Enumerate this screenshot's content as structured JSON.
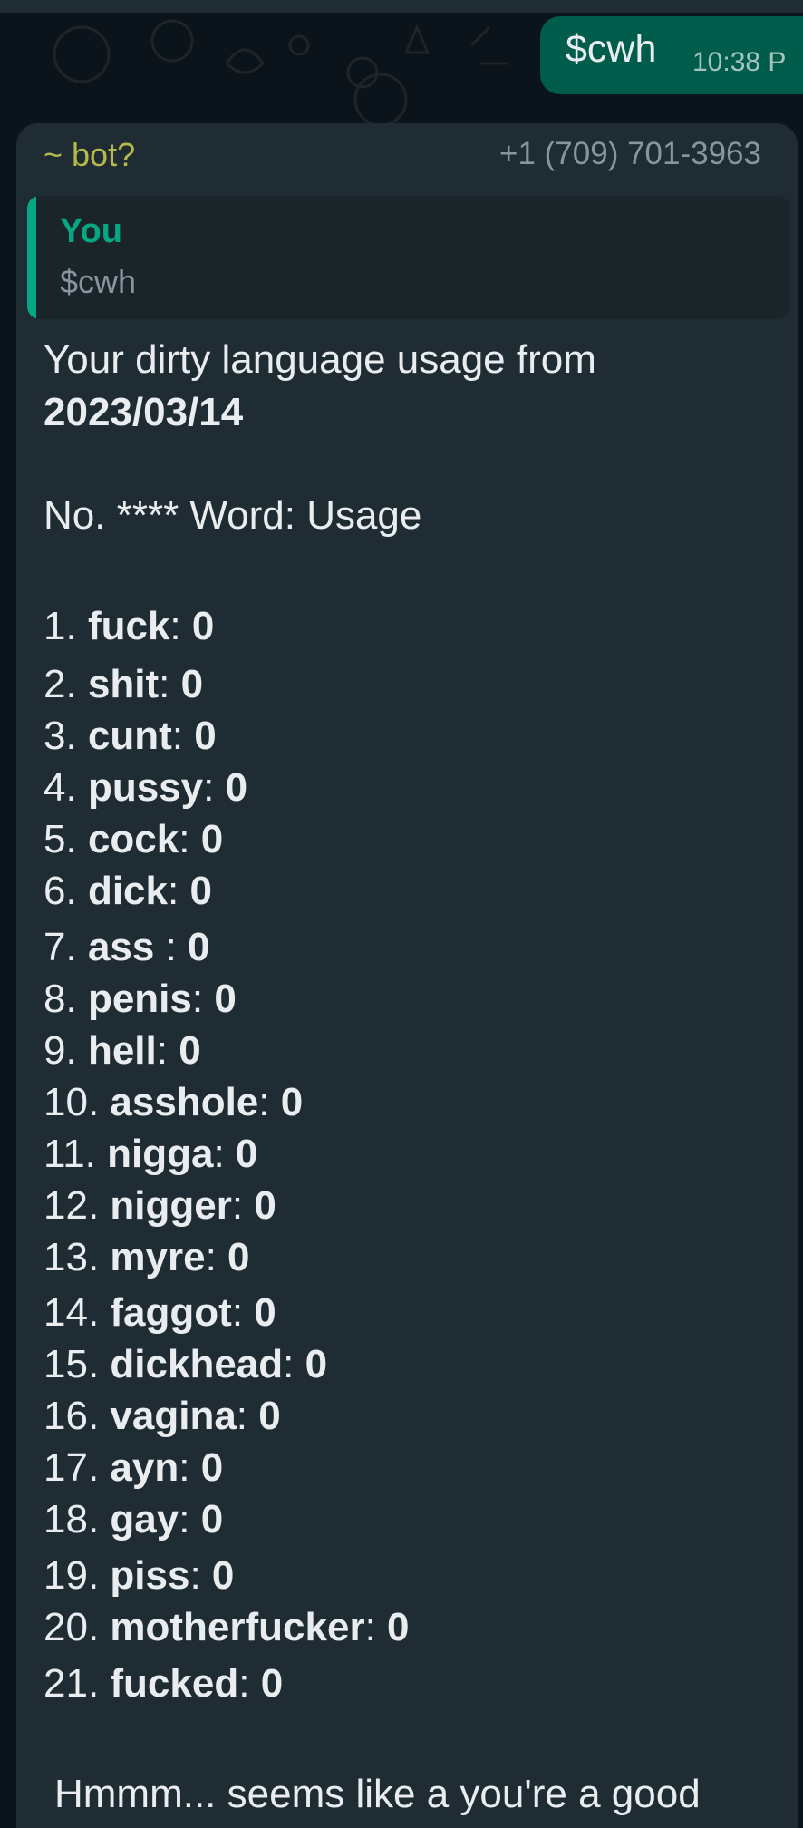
{
  "outgoing": {
    "text": "$cwh",
    "time": "10:38 P"
  },
  "incoming": {
    "sender": "~ bot?",
    "phone": "+1 (709) 701-3963",
    "quote": {
      "author": "You",
      "text": "$cwh"
    },
    "intro_line": "Your dirty language usage from",
    "date": "2023/03/14",
    "header_line": "No. **** Word: Usage",
    "words": [
      {
        "no": "1.",
        "word": "fuck",
        "sep": ": ",
        "count": "0"
      },
      {
        "no": "2.",
        "word": "shit",
        "sep": ": ",
        "count": "0"
      },
      {
        "no": "3.",
        "word": "cunt",
        "sep": ": ",
        "count": "0"
      },
      {
        "no": "4.",
        "word": "pussy",
        "sep": ": ",
        "count": "0"
      },
      {
        "no": "5.",
        "word": "cock",
        "sep": ": ",
        "count": "0"
      },
      {
        "no": "6.",
        "word": "dick",
        "sep": ": ",
        "count": "0"
      },
      {
        "no": "7.",
        "word": "ass",
        "sep": " : ",
        "count": "0"
      },
      {
        "no": "8.",
        "word": "penis",
        "sep": ": ",
        "count": "0"
      },
      {
        "no": "9.",
        "word": "hell",
        "sep": ": ",
        "count": "0"
      },
      {
        "no": "10.",
        "word": "asshole",
        "sep": ": ",
        "count": "0"
      },
      {
        "no": "11.",
        "word": "nigga",
        "sep": ": ",
        "count": "0"
      },
      {
        "no": "12.",
        "word": "nigger",
        "sep": ": ",
        "count": "0"
      },
      {
        "no": "13.",
        "word": "myre",
        "sep": ": ",
        "count": "0"
      },
      {
        "no": "14.",
        "word": "faggot",
        "sep": ": ",
        "count": "0"
      },
      {
        "no": "15.",
        "word": "dickhead",
        "sep": ": ",
        "count": "0"
      },
      {
        "no": "16.",
        "word": "vagina",
        "sep": ": ",
        "count": "0"
      },
      {
        "no": "17.",
        "word": "ayn",
        "sep": ": ",
        "count": "0"
      },
      {
        "no": "18.",
        "word": "gay",
        "sep": ": ",
        "count": "0"
      },
      {
        "no": "19.",
        "word": "piss",
        "sep": ": ",
        "count": "0"
      },
      {
        "no": "20.",
        "word": "motherfucker",
        "sep": ": ",
        "count": "0"
      },
      {
        "no": "21.",
        "word": "fucked",
        "sep": ": ",
        "count": "0"
      }
    ],
    "closing_partial": "Hmmm... seems like a you're a good"
  },
  "colors": {
    "background": "#0b141a",
    "outgoing_bubble": "#005c4b",
    "incoming_bubble": "#202c33",
    "quote_accent": "#06a884",
    "sender_name": "#b5b84a",
    "secondary_text": "#8696a0"
  }
}
